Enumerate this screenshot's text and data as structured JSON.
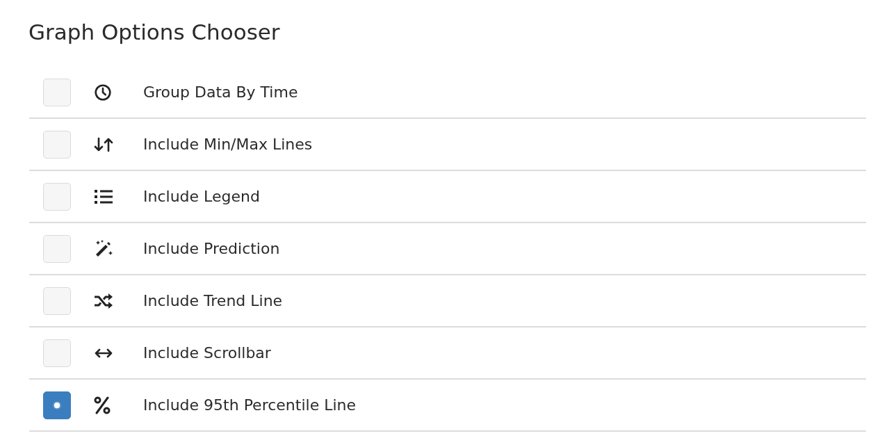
{
  "title": "Graph Options Chooser",
  "options": [
    {
      "label": "Group Data By Time",
      "checked": false
    },
    {
      "label": "Include Min/Max Lines",
      "checked": false
    },
    {
      "label": "Include Legend",
      "checked": false
    },
    {
      "label": "Include Prediction",
      "checked": false
    },
    {
      "label": "Include Trend Line",
      "checked": false
    },
    {
      "label": "Include Scrollbar",
      "checked": false
    },
    {
      "label": "Include 95th Percentile Line",
      "checked": true
    }
  ]
}
